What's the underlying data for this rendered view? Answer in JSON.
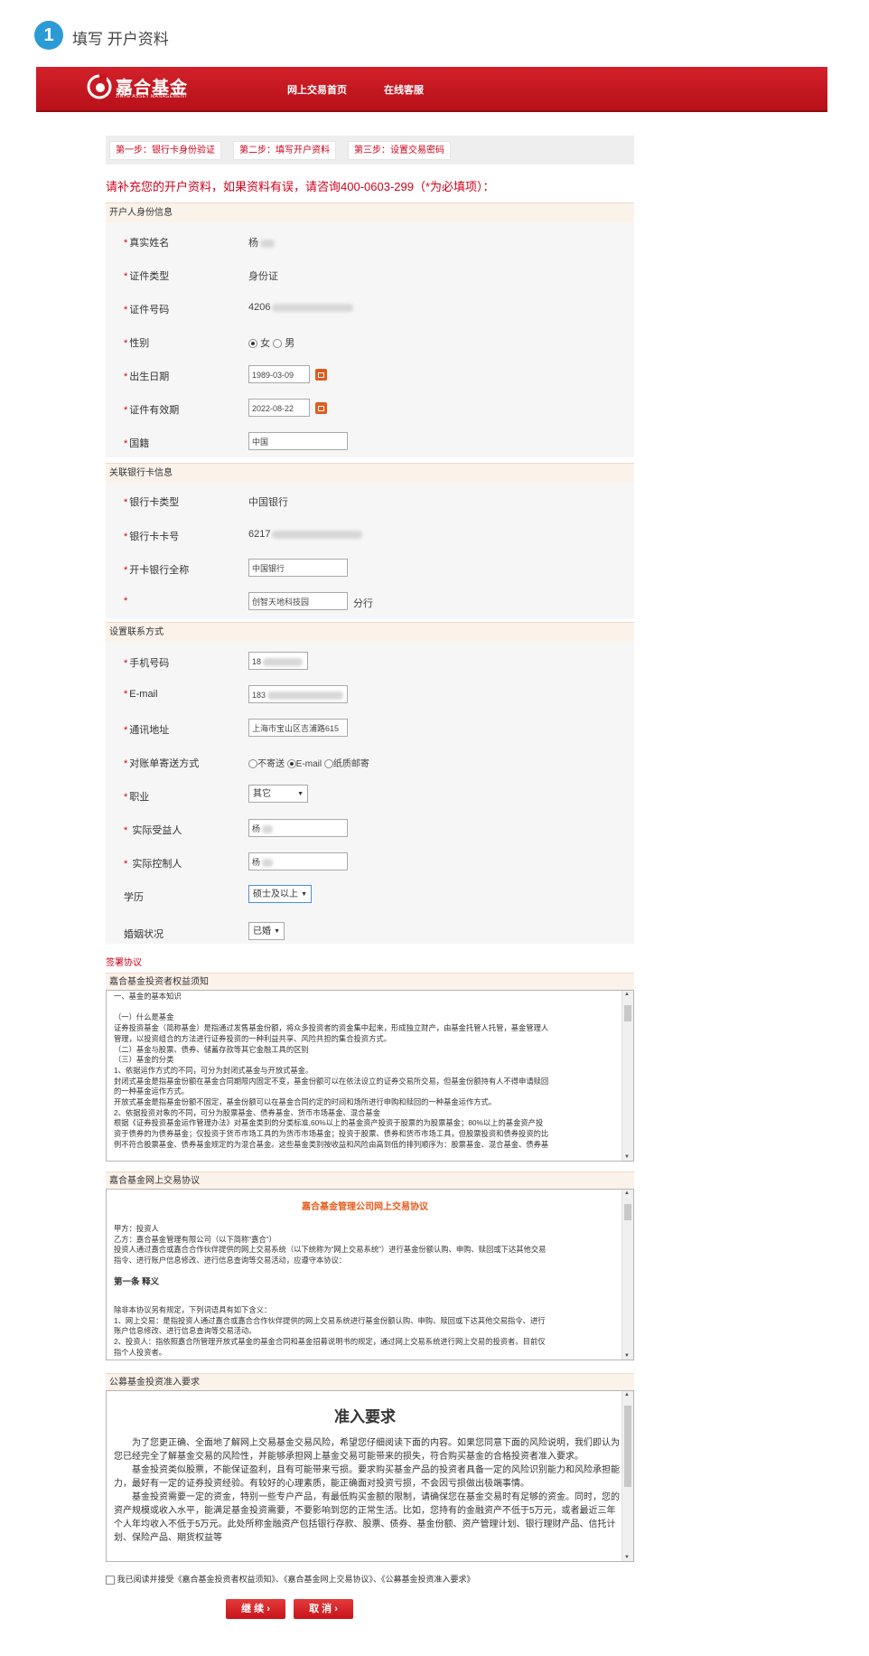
{
  "heading": {
    "step": "1",
    "title": "填写 开户资料"
  },
  "topbar": {
    "logo_text": "嘉合基金",
    "logo_sub": "JIAHE ASSET MANAGEMENT",
    "nav": [
      "网上交易首页",
      "在线客服"
    ],
    "colors": {
      "bar": "#c8151e",
      "accent": "#d0021b"
    }
  },
  "steps": [
    "第一步：银行卡身份验证",
    "第二步：填写开户资料",
    "第三步：设置交易密码"
  ],
  "notice": "请补充您的开户资料，如果资料有误，请咨询400-0603-299（*为必填项）：",
  "identity": {
    "title": "开户人身份信息",
    "name_label": "真实姓名",
    "name_value": "杨",
    "idtype_label": "证件类型",
    "idtype_value": "身份证",
    "idno_label": "证件号码",
    "idno_value": "4206",
    "gender_label": "性别",
    "gender_female": "女",
    "gender_male": "男",
    "birth_label": "出生日期",
    "birth_value": "1989-03-09",
    "validity_label": "证件有效期",
    "validity_value": "2022-08-22",
    "nation_label": "国籍",
    "nation_value": "中国"
  },
  "bank": {
    "title": "关联银行卡信息",
    "type_label": "银行卡类型",
    "type_value": "中国银行",
    "no_label": "银行卡卡号",
    "no_value": "6217",
    "fullname_label": "开卡银行全称",
    "fullname_value": "中国银行",
    "branch_value": "创智天地科技园",
    "branch_suffix": "分行"
  },
  "contact": {
    "title": "设置联系方式",
    "phone_label": "手机号码",
    "phone_value": "18",
    "email_label": "E-mail",
    "email_value": "183",
    "address_label": "通讯地址",
    "address_value": "上海市宝山区吉浦路615",
    "statement_label": "对账单寄送方式",
    "statement_opts": [
      "不寄送",
      "E-mail",
      "纸质邮寄"
    ],
    "job_label": "职业",
    "job_value": "其它",
    "beneficiary_label": "实际受益人",
    "beneficiary_value": "杨",
    "controller_label": "实际控制人",
    "controller_value": "杨",
    "edu_label": "学历",
    "edu_value": "硕士及以上",
    "marital_label": "婚姻状况",
    "marital_value": "已婚"
  },
  "agreements": {
    "title": "签署协议",
    "box1_title": "嘉合基金投资者权益须知",
    "box1_lines": [
      "一、基金的基本知识",
      "",
      "（一）什么是基金",
      "证券投资基金（简称基金）是指通过发售基金份额，将众多投资者的资金集中起来，形成独立财产，由基金托管人托管，基金管理人",
      "管理，以投资组合的方法进行证券投资的一种利益共享、风险共担的集合投资方式。",
      "（二）基金与股票、债券、储蓄存款等其它金融工具的区别",
      "（三）基金的分类",
      "1、依据运作方式的不同，可分为封闭式基金与开放式基金。",
      "封闭式基金是指基金份额在基金合同期限内固定不变，基金份额可以在依法设立的证券交易所交易，但基金份额持有人不得申请赎回",
      "的一种基金运作方式。",
      "开放式基金是指基金份额不固定，基金份额可以在基金合同约定的时间和场所进行申购和赎回的一种基金运作方式。",
      "2、依据投资对象的不同，可分为股票基金、债券基金、货币市场基金、混合基金",
      "根据《证券投资基金运作管理办法》对基金类别的分类标准,60%以上的基金资产投资于股票的为股票基金；80%以上的基金资产投",
      "资于债券的为债券基金；仅投资于货币市场工具的为货币市场基金；投资于股票、债券和货币市场工具，但股票投资和债券投资的比",
      "例不符合股票基金、债券基金规定的为混合基金。这些基金类别按收益和风险由高到低的排列顺序为：股票基金、混合基金、债券基"
    ],
    "box2_title": "嘉合基金网上交易协议",
    "box2_heading": "嘉合基金管理公司网上交易协议",
    "box2_lines": [
      "甲方：投资人",
      "乙方：嘉合基金管理有限公司（以下简称“嘉合”）",
      "投资人通过嘉合或嘉合合作伙伴提供的网上交易系统（以下统称为“网上交易系统”）进行基金份额认购、申购、赎回或下达其他交易",
      "指令、进行账户信息修改、进行信息查询等交易活动，应遵守本协议："
    ],
    "box2_section": "第一条 释义",
    "box2_lines2": [
      "除非本协议另有规定，下列词语具有如下含义：",
      "1、网上交易：是指投资人通过嘉合或嘉合合作伙伴提供的网上交易系统进行基金份额认购、申购、赎回或下达其他交易指令、进行",
      "账户信息修改、进行信息查询等交易活动。",
      "2、投资人：指依照嘉合所管理开放式基金的基金合同和基金招募说明书的规定，通过网上交易系统进行网上交易的投资者。目前仅",
      "指个人投资者。"
    ],
    "box3_title": "公募基金投资准入要求",
    "box3_heading": "准入要求",
    "box3_lines": [
      "为了您更正确、全面地了解网上交易基金交易风险，希望您仔细阅读下面的内容。如果您同意下面的风险说明，我们即认为您已经完全了解基金交易的风险性，并能够承担网上基金交易可能带来的损失，符合购买基金的合格投资者准入要求。",
      "基金投资类似股票，不能保证盈利，且有可能带来亏损。要求购买基金产品的投资者具备一定的风险识别能力和风险承担能力，最好有一定的证券投资经验。有较好的心理素质，能正确面对投资亏损，不会因亏损做出极端事情。",
      "基金投资需要一定的资金，特别一些专户产品，有最低购买金额的限制，请确保您在基金交易时有足够的资金。同时，您的资产规模或收入水平，能满足基金投资需要，不要影响到您的正常生活。比如，您持有的金融资产不低于5万元，或者最近三年个人年均收入不低于5万元。此处所称金融资产包括银行存款、股票、债券、基金份额、资产管理计划、银行理财产品、信托计划、保险产品、期货权益等"
    ],
    "consent": "我已阅读并接受《嘉合基金投资者权益须知》、《嘉合基金网上交易协议》、《公募基金投资准入要求》"
  },
  "buttons": {
    "next": "继 续",
    "cancel": "取 消"
  }
}
